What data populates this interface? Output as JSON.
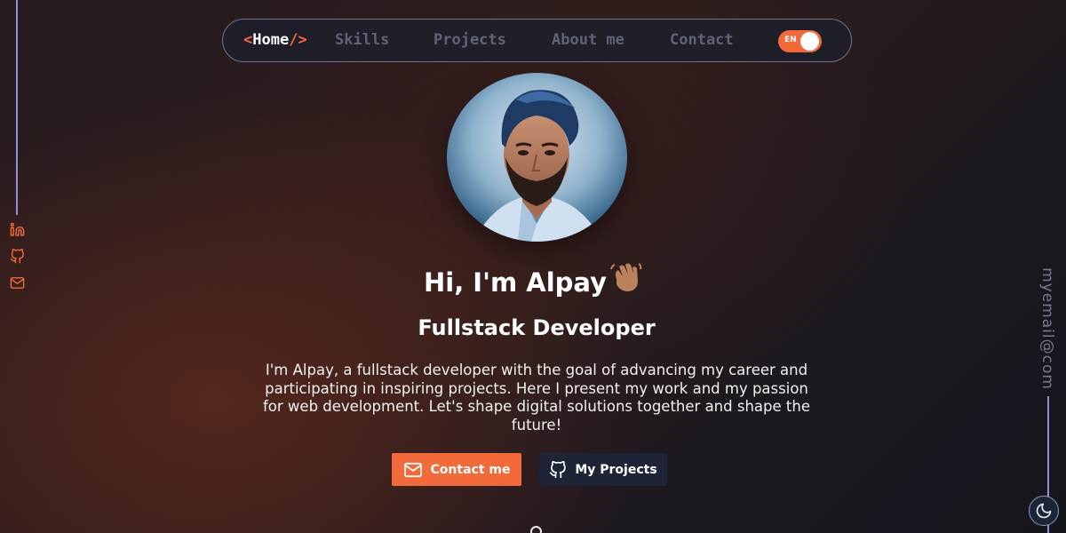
{
  "nav": {
    "home_open": "<",
    "home_label": "Home",
    "home_close": "/>",
    "items": [
      "Skills",
      "Projects",
      "About me",
      "Contact"
    ],
    "language": "EN"
  },
  "hero": {
    "greeting": "Hi, I'm Alpay",
    "greeting_emoji": "waving-hand-icon",
    "role": "Fullstack Developer",
    "description": "I'm Alpay, a fullstack developer with the goal of advancing my career and participating in inspiring projects. Here I present my work and my passion for web development. Let's shape digital solutions together and shape the future!"
  },
  "buttons": {
    "contact": "Contact me",
    "projects": "My Projects"
  },
  "sidebar": {
    "email_vertical": "myemail@com",
    "socials": [
      "linkedin-icon",
      "github-icon",
      "mail-icon"
    ]
  },
  "colors": {
    "accent": "#f26a3a",
    "dark_button": "#1d2436",
    "rail_line": "#8f8fd8"
  }
}
